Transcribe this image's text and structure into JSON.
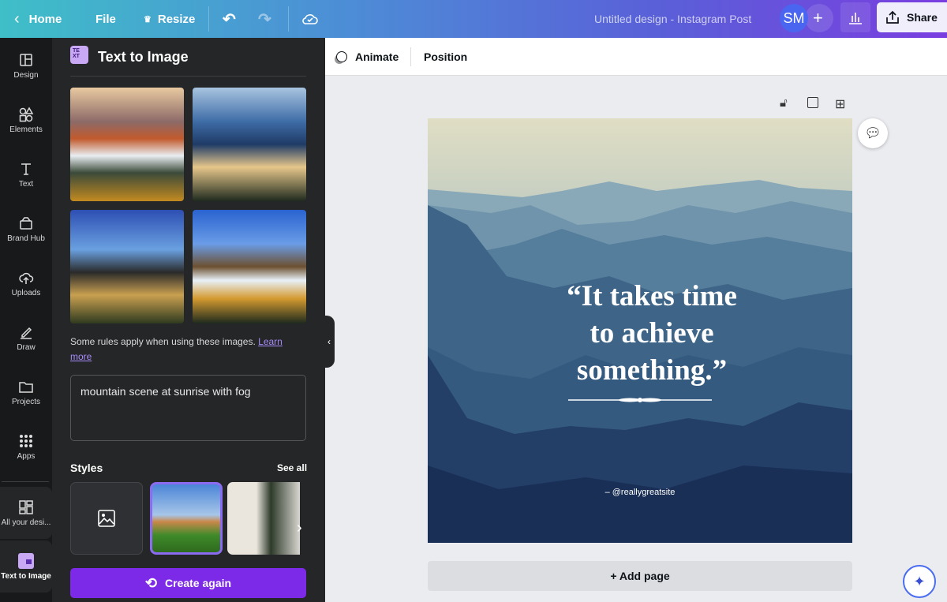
{
  "topbar": {
    "home": "Home",
    "file": "File",
    "resize": "Resize",
    "title": "Untitled design - Instagram Post",
    "avatar": "SM",
    "share": "Share"
  },
  "rail": [
    {
      "label": "Design",
      "icon": "layout-icon"
    },
    {
      "label": "Elements",
      "icon": "shapes-icon"
    },
    {
      "label": "Text",
      "icon": "text-icon"
    },
    {
      "label": "Brand Hub",
      "icon": "brand-icon"
    },
    {
      "label": "Uploads",
      "icon": "cloud-upload-icon"
    },
    {
      "label": "Draw",
      "icon": "pen-icon"
    },
    {
      "label": "Projects",
      "icon": "folder-icon"
    },
    {
      "label": "Apps",
      "icon": "grid-icon"
    },
    {
      "label": "All your desi...",
      "icon": "designs-icon"
    },
    {
      "label": "Text to Image",
      "icon": "text-to-image-icon"
    }
  ],
  "panel": {
    "title": "Text to Image",
    "rules": "Some rules apply when using these images.",
    "learn_more": "Learn more",
    "prompt": "mountain scene at sunrise with fog",
    "styles": "Styles",
    "see_all": "See all",
    "create": "Create again"
  },
  "toolbar": {
    "animate": "Animate",
    "position": "Position"
  },
  "design": {
    "line1": "“It takes time",
    "line2": "to achieve",
    "line3": "something.”",
    "credit": "– @reallygreatsite"
  },
  "canvas": {
    "add_page": "+ Add page"
  },
  "colors": {
    "accent": "#7d2ae8",
    "panel": "#252627",
    "rail": "#18191b"
  }
}
